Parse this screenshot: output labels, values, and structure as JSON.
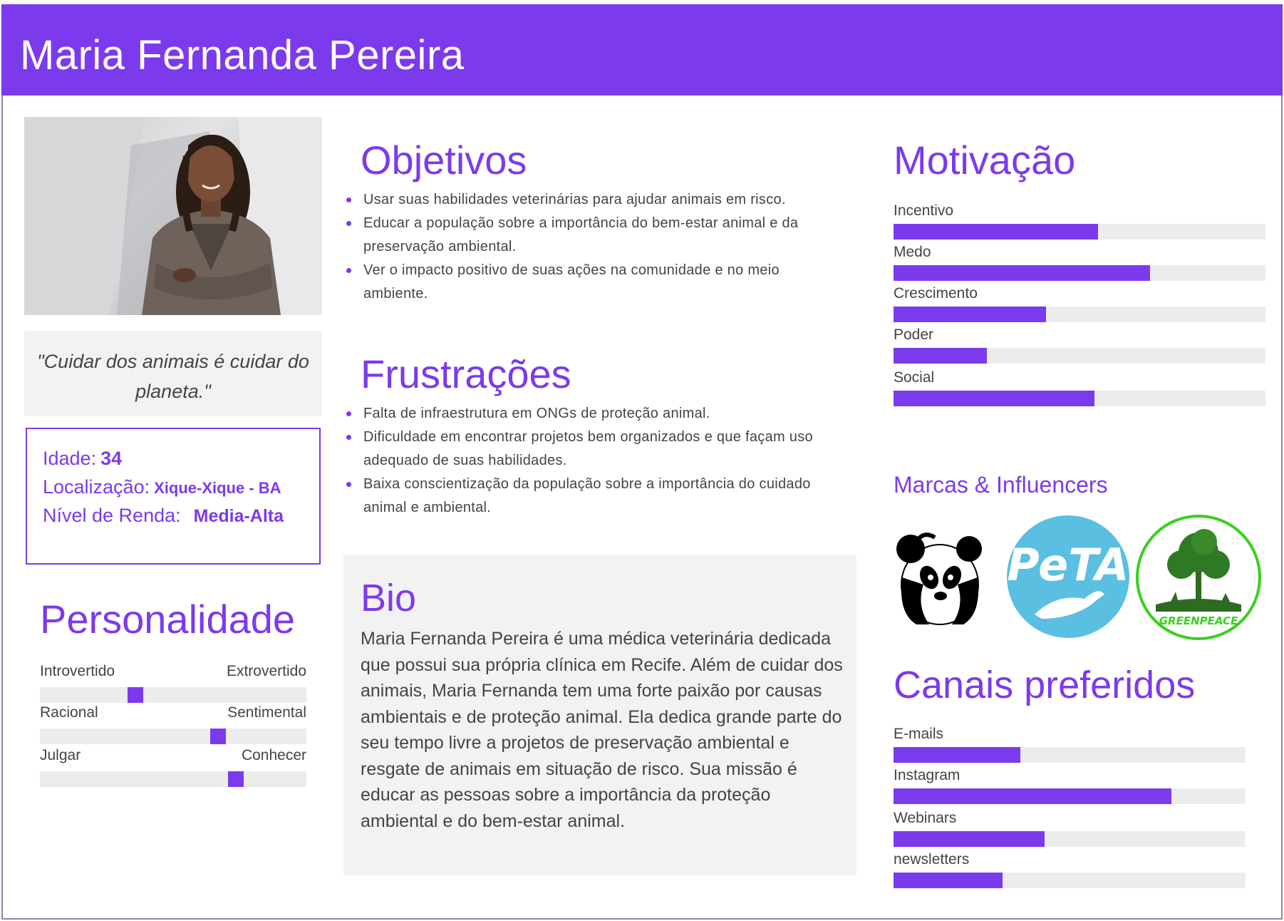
{
  "persona": {
    "name": "Maria Fernanda Pereira",
    "quote": "\"Cuidar dos animais é cuidar do planeta.\"",
    "age_label": "Idade:",
    "age": "34",
    "location_label": "Localização:",
    "location": "Xique-Xique - BA",
    "income_label": "Nível de Renda:",
    "income": "Media-Alta"
  },
  "personality": {
    "title": "Personalidade",
    "traits": [
      {
        "left": "Introvertido",
        "right": "Extrovertido",
        "value": 0.35
      },
      {
        "left": "Racional",
        "right": "Sentimental",
        "value": 0.68
      },
      {
        "left": "Julgar",
        "right": "Conhecer",
        "value": 0.75
      }
    ]
  },
  "goals": {
    "title": "Objetivos",
    "items": [
      "Usar suas habilidades veterinárias para ajudar animais em risco.",
      "Educar a população sobre a importância do bem-estar animal e da preservação ambiental.",
      "Ver o impacto positivo de suas ações na comunidade e no meio ambiente."
    ]
  },
  "frustrations": {
    "title": "Frustrações",
    "items": [
      "Falta de infraestrutura em ONGs de proteção animal.",
      "Dificuldade em encontrar projetos bem organizados e que façam uso adequado de suas habilidades.",
      "Baixa conscientização da população sobre a importância do cuidado animal e ambiental."
    ]
  },
  "bio": {
    "title": "Bio",
    "text": "Maria Fernanda Pereira é uma médica veterinária dedicada que possui sua própria clínica em Recife. Além de cuidar dos animais, Maria Fernanda tem uma forte paixão por causas ambientais e de proteção animal. Ela dedica grande parte do seu tempo livre a projetos de preservação ambiental e resgate de animais em situação de risco. Sua missão é educar as pessoas sobre a importância da proteção ambiental e do bem-estar animal."
  },
  "motivation": {
    "title": "Motivação",
    "bars": [
      {
        "label": "Incentivo",
        "value": 0.55
      },
      {
        "label": "Medo",
        "value": 0.69
      },
      {
        "label": "Crescimento",
        "value": 0.41
      },
      {
        "label": "Poder",
        "value": 0.25
      },
      {
        "label": "Social",
        "value": 0.54
      }
    ]
  },
  "brands": {
    "title": "Marcas & Influencers",
    "logos": [
      {
        "icon": "panda-logo-icon"
      },
      {
        "icon": "peta-logo-icon",
        "text": "PeTA"
      },
      {
        "icon": "greenpeace-logo-icon",
        "text": "GREENPEACE"
      }
    ]
  },
  "channels": {
    "title": "Canais preferidos",
    "bars": [
      {
        "label": "E-mails",
        "value": 0.36
      },
      {
        "label": "Instagram",
        "value": 0.79
      },
      {
        "label": "Webinars",
        "value": 0.43
      },
      {
        "label": "newsletters",
        "value": 0.31
      }
    ]
  },
  "colors": {
    "accent": "#7c3aed",
    "track": "#ececec",
    "panel": "#f2f2f2"
  }
}
